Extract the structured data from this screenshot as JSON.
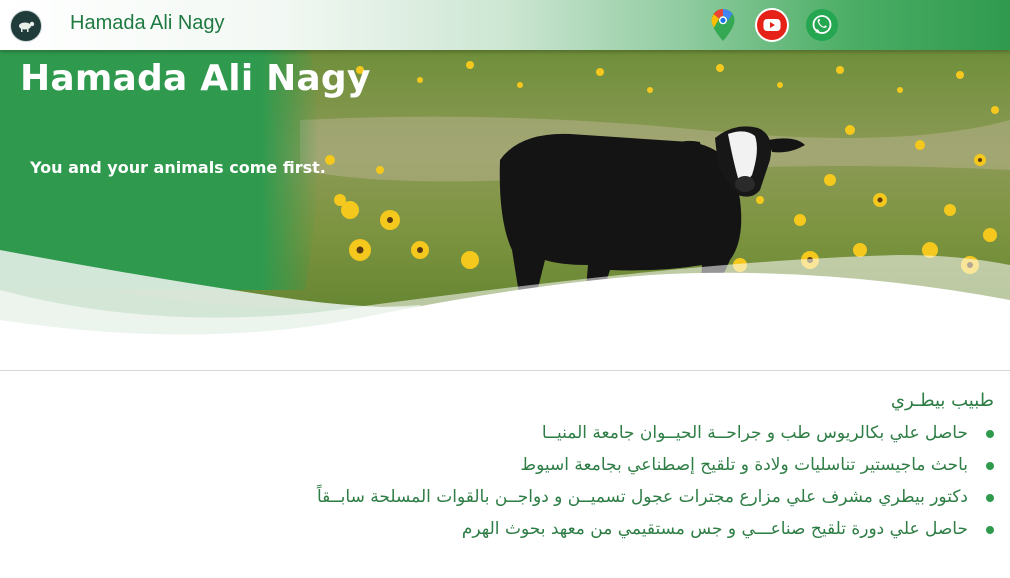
{
  "header": {
    "brand": "Hamada Ali Nagy",
    "logo_icon": "cow-logo-icon",
    "social": [
      {
        "name": "google-maps-icon"
      },
      {
        "name": "youtube-icon",
        "color": "#e62117"
      },
      {
        "name": "whatsapp-icon",
        "color": "#25a651"
      }
    ]
  },
  "hero": {
    "title": "Hamada Ali Nagy",
    "subtitle": "You and your animals come first.",
    "image": "cow-in-sunflower-field"
  },
  "about": {
    "heading": "طبيب بيطـري",
    "items": [
      "حاصل علي بكالريوس طب و جراحــة الحيــوان جامعة المنيــا",
      "باحث ماجيستير تناسليات ولادة و تلقيح إصطناعي بجامعة اسيوط",
      "دكتور بيطري مشرف علي مزارع مجترات عجول تسميــن و دواجــن بالقوات المسلحة سابــقاً",
      "حاصل علي دورة تلقيح صناعـــي و جس مستقيمي من معهد بحوث الهرم"
    ]
  },
  "colors": {
    "primary_green": "#2f9a4e",
    "text_green": "#2e7d45"
  }
}
